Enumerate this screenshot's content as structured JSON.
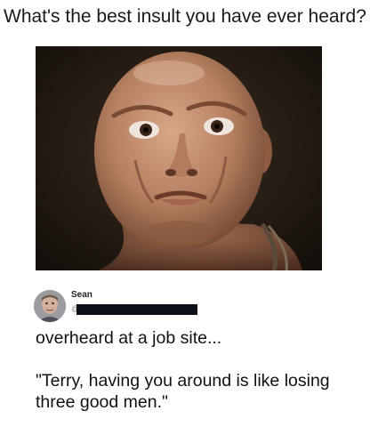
{
  "post": {
    "title": "What's the best insult you have ever heard?"
  },
  "image": {
    "subject": "meme-face-photo"
  },
  "tweet": {
    "author_name": "Sean",
    "handle_prefix": "@",
    "handle_redacted": true,
    "text_line1": "overheard at a job site...",
    "text_line2": "\"Terry, having you around is like losing three good men.\""
  },
  "colors": {
    "background": "#ffffff",
    "text": "#111111",
    "redaction_bar": "#0d1117",
    "photo_background": "#1e1711"
  }
}
